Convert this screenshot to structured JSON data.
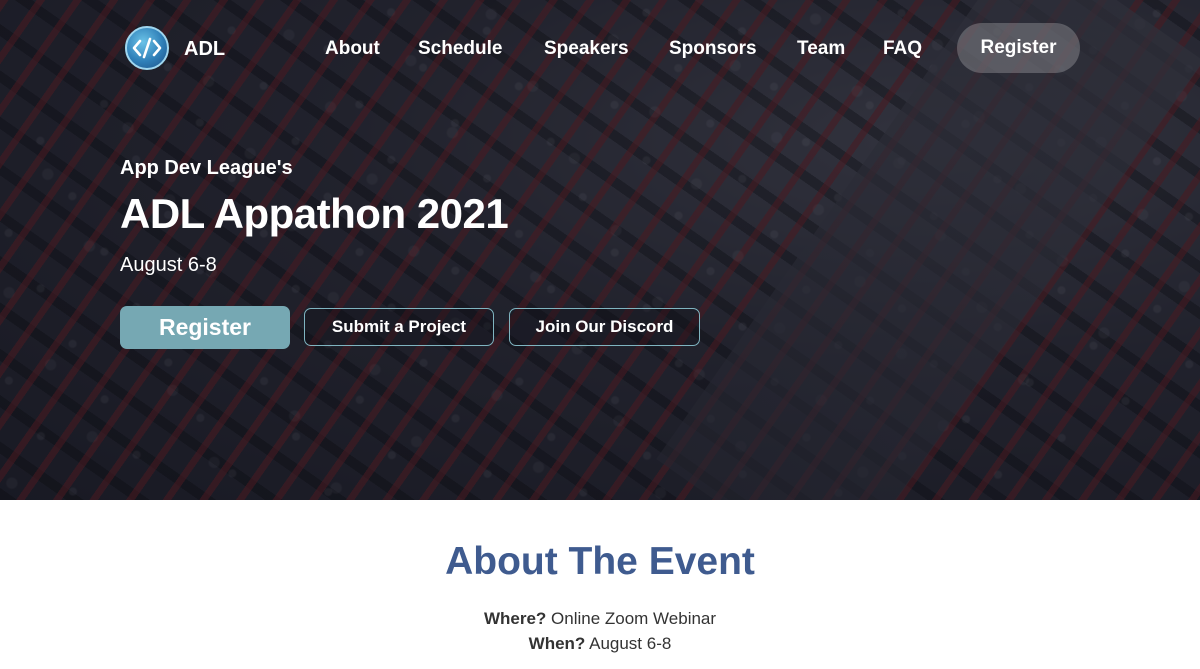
{
  "nav": {
    "brand": "ADL",
    "links": [
      "About",
      "Schedule",
      "Speakers",
      "Sponsors",
      "Team",
      "FAQ"
    ],
    "register_label": "Register"
  },
  "hero": {
    "kicker": "App Dev League's",
    "title": "ADL Appathon 2021",
    "date": "August 6-8",
    "buttons": {
      "register": "Register",
      "submit": "Submit a Project",
      "discord": "Join Our Discord"
    }
  },
  "about": {
    "title": "About The Event",
    "where_label": "Where?",
    "where_value": "Online Zoom Webinar",
    "when_label": "When?",
    "when_value": "August 6-8"
  },
  "colors": {
    "accent": "#76a8b3",
    "heading": "#3f5b8f"
  },
  "icons": {
    "logo": "code-brackets-globe-icon"
  }
}
